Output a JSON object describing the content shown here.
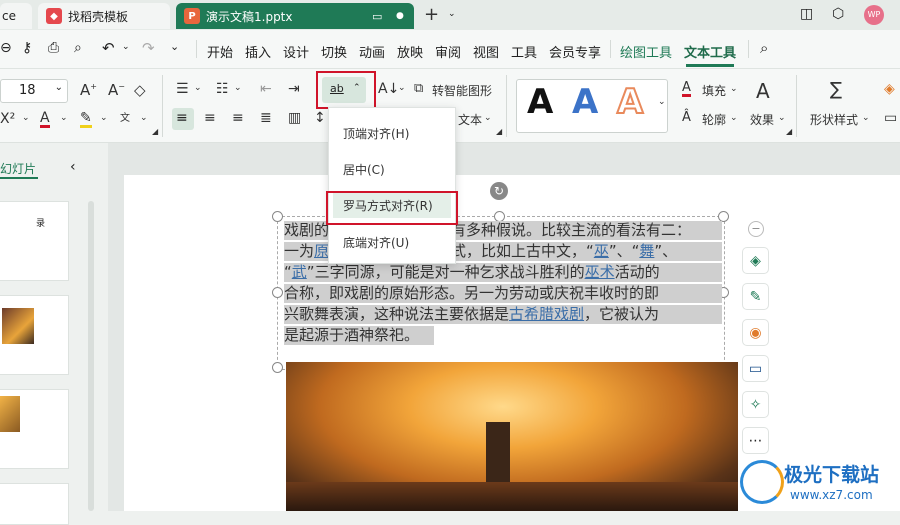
{
  "tabs": {
    "tab1": "ce",
    "tab2": "找稻壳模板",
    "tab3": "演示文稿1.pptx",
    "add": "+"
  },
  "user_avatar": "WP",
  "menu": [
    "开始",
    "插入",
    "设计",
    "切换",
    "动画",
    "放映",
    "审阅",
    "视图",
    "工具",
    "会员专享",
    "绘图工具",
    "文本工具"
  ],
  "ribbon": {
    "font_size": "18",
    "smart_shape": "转智能图形",
    "text_label": "文本",
    "fill": "填充",
    "outline": "轮廓",
    "effect": "效果",
    "shape_style": "形状样式",
    "art_letters": [
      "A",
      "A",
      "A"
    ],
    "align_button": "ab"
  },
  "left_panel": {
    "label": "幻灯片",
    "thumb_text": "录"
  },
  "dropdown": {
    "items": [
      "顶端对齐(H)",
      "居中(C)",
      "罗马方式对齐(R)",
      "底端对齐(U)"
    ],
    "highlighted_index": 2
  },
  "slide_text": {
    "l1a": "戏剧的",
    "l1b": "有多种假说。比较主流的看法有二：",
    "l2a": "一为",
    "l2link": "原",
    "l2b": "式，比如上古中文，“",
    "l2link2": "巫",
    "l2c": "”、“",
    "l2link3": "舞",
    "l2d": "”、",
    "l3a": "“",
    "l3link": "武",
    "l3b": "”三字同源，可能是对一种乞求战斗胜利的",
    "l3link2": "巫术",
    "l3c": "活动的",
    "l4": "合称，即戏剧的原始形态。另一为劳动或庆祝丰收时的即",
    "l5a": "兴歌舞表演，这种说法主要依据是",
    "l5link": "古希腊戏剧",
    "l5b": "，它被认为",
    "l6": "是起源于酒神祭祀。"
  },
  "watermark": {
    "title": "极光下载站",
    "url": "www.xz7.com"
  }
}
